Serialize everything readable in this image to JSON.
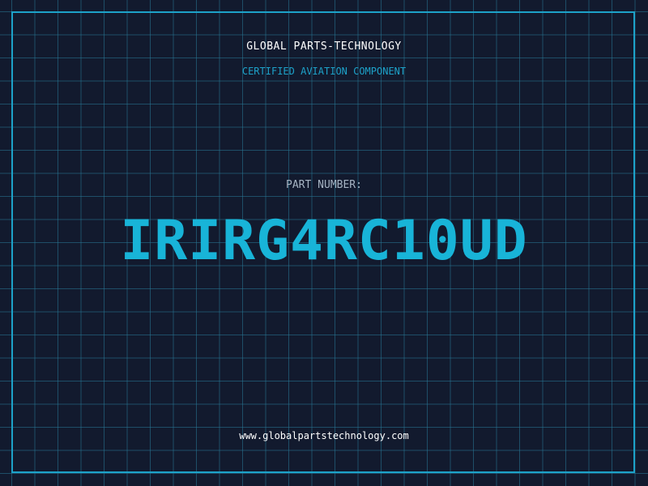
{
  "header": {
    "company": "GLOBAL PARTS-TECHNOLOGY",
    "subtitle": "CERTIFIED AVIATION COMPONENT"
  },
  "part": {
    "label": "PART NUMBER:",
    "number": "IRIRG4RC10UD"
  },
  "footer": {
    "website": "www.globalpartstechnology.com"
  },
  "colors": {
    "background": "#121a2e",
    "accent": "#1da2c9",
    "part_number": "#18b4d8",
    "label": "#a6b4c3",
    "text": "#ffffff"
  }
}
